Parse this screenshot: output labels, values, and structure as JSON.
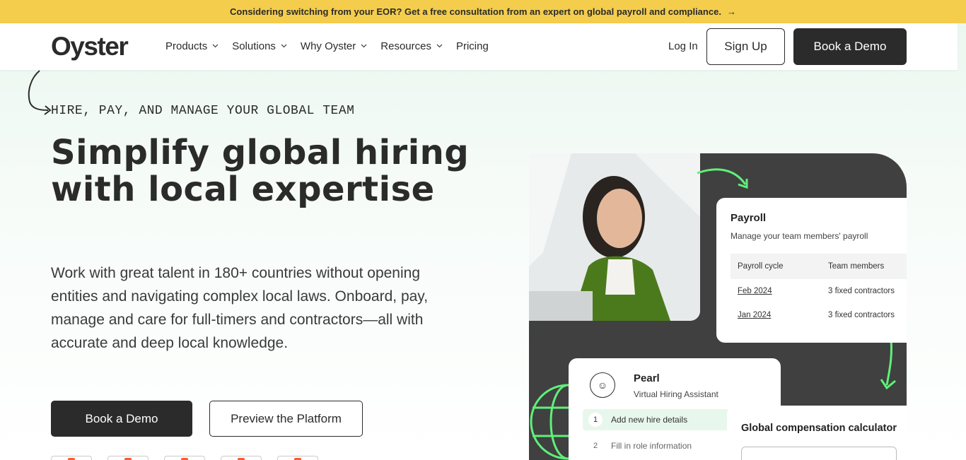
{
  "banner": {
    "text": "Considering switching from your EOR? Get a free consultation from an expert on global payroll and compliance.",
    "arrow": "→"
  },
  "nav": {
    "logo": "Oyster",
    "items": [
      {
        "label": "Products",
        "has_dropdown": true
      },
      {
        "label": "Solutions",
        "has_dropdown": true
      },
      {
        "label": "Why Oyster",
        "has_dropdown": true
      },
      {
        "label": "Resources",
        "has_dropdown": true
      },
      {
        "label": "Pricing",
        "has_dropdown": false
      }
    ],
    "login": "Log In",
    "signup": "Sign Up",
    "demo": "Book a Demo"
  },
  "hero": {
    "eyebrow": "HIRE, PAY, AND MANAGE YOUR GLOBAL TEAM",
    "headline": "Simplify global hiring with local expertise",
    "subcopy": "Work with great talent in 180+ countries without opening entities and navigating complex local laws. Onboard, pay, manage and care for full-timers and contractors—all with accurate and deep local knowledge.",
    "cta_primary": "Book a Demo",
    "cta_secondary": "Preview the Platform"
  },
  "payroll_card": {
    "title": "Payroll",
    "subtitle": "Manage your team members' payroll",
    "columns": [
      "Payroll cycle",
      "Team members"
    ],
    "rows": [
      [
        "Feb 2024",
        "3 fixed contractors"
      ],
      [
        "Jan 2024",
        "3 fixed contractors"
      ]
    ]
  },
  "pearl_card": {
    "name": "Pearl",
    "role": "Virtual Hiring Assistant",
    "steps": [
      {
        "num": "1",
        "label": "Add new hire details"
      },
      {
        "num": "2",
        "label": "Fill in role information"
      }
    ]
  },
  "calc_card": {
    "title": "Global compensation calculator"
  },
  "colors": {
    "banner": "#f5cd4d",
    "dark": "#2b2b2b",
    "accent_green": "#5ff07a",
    "panel": "#404040"
  }
}
